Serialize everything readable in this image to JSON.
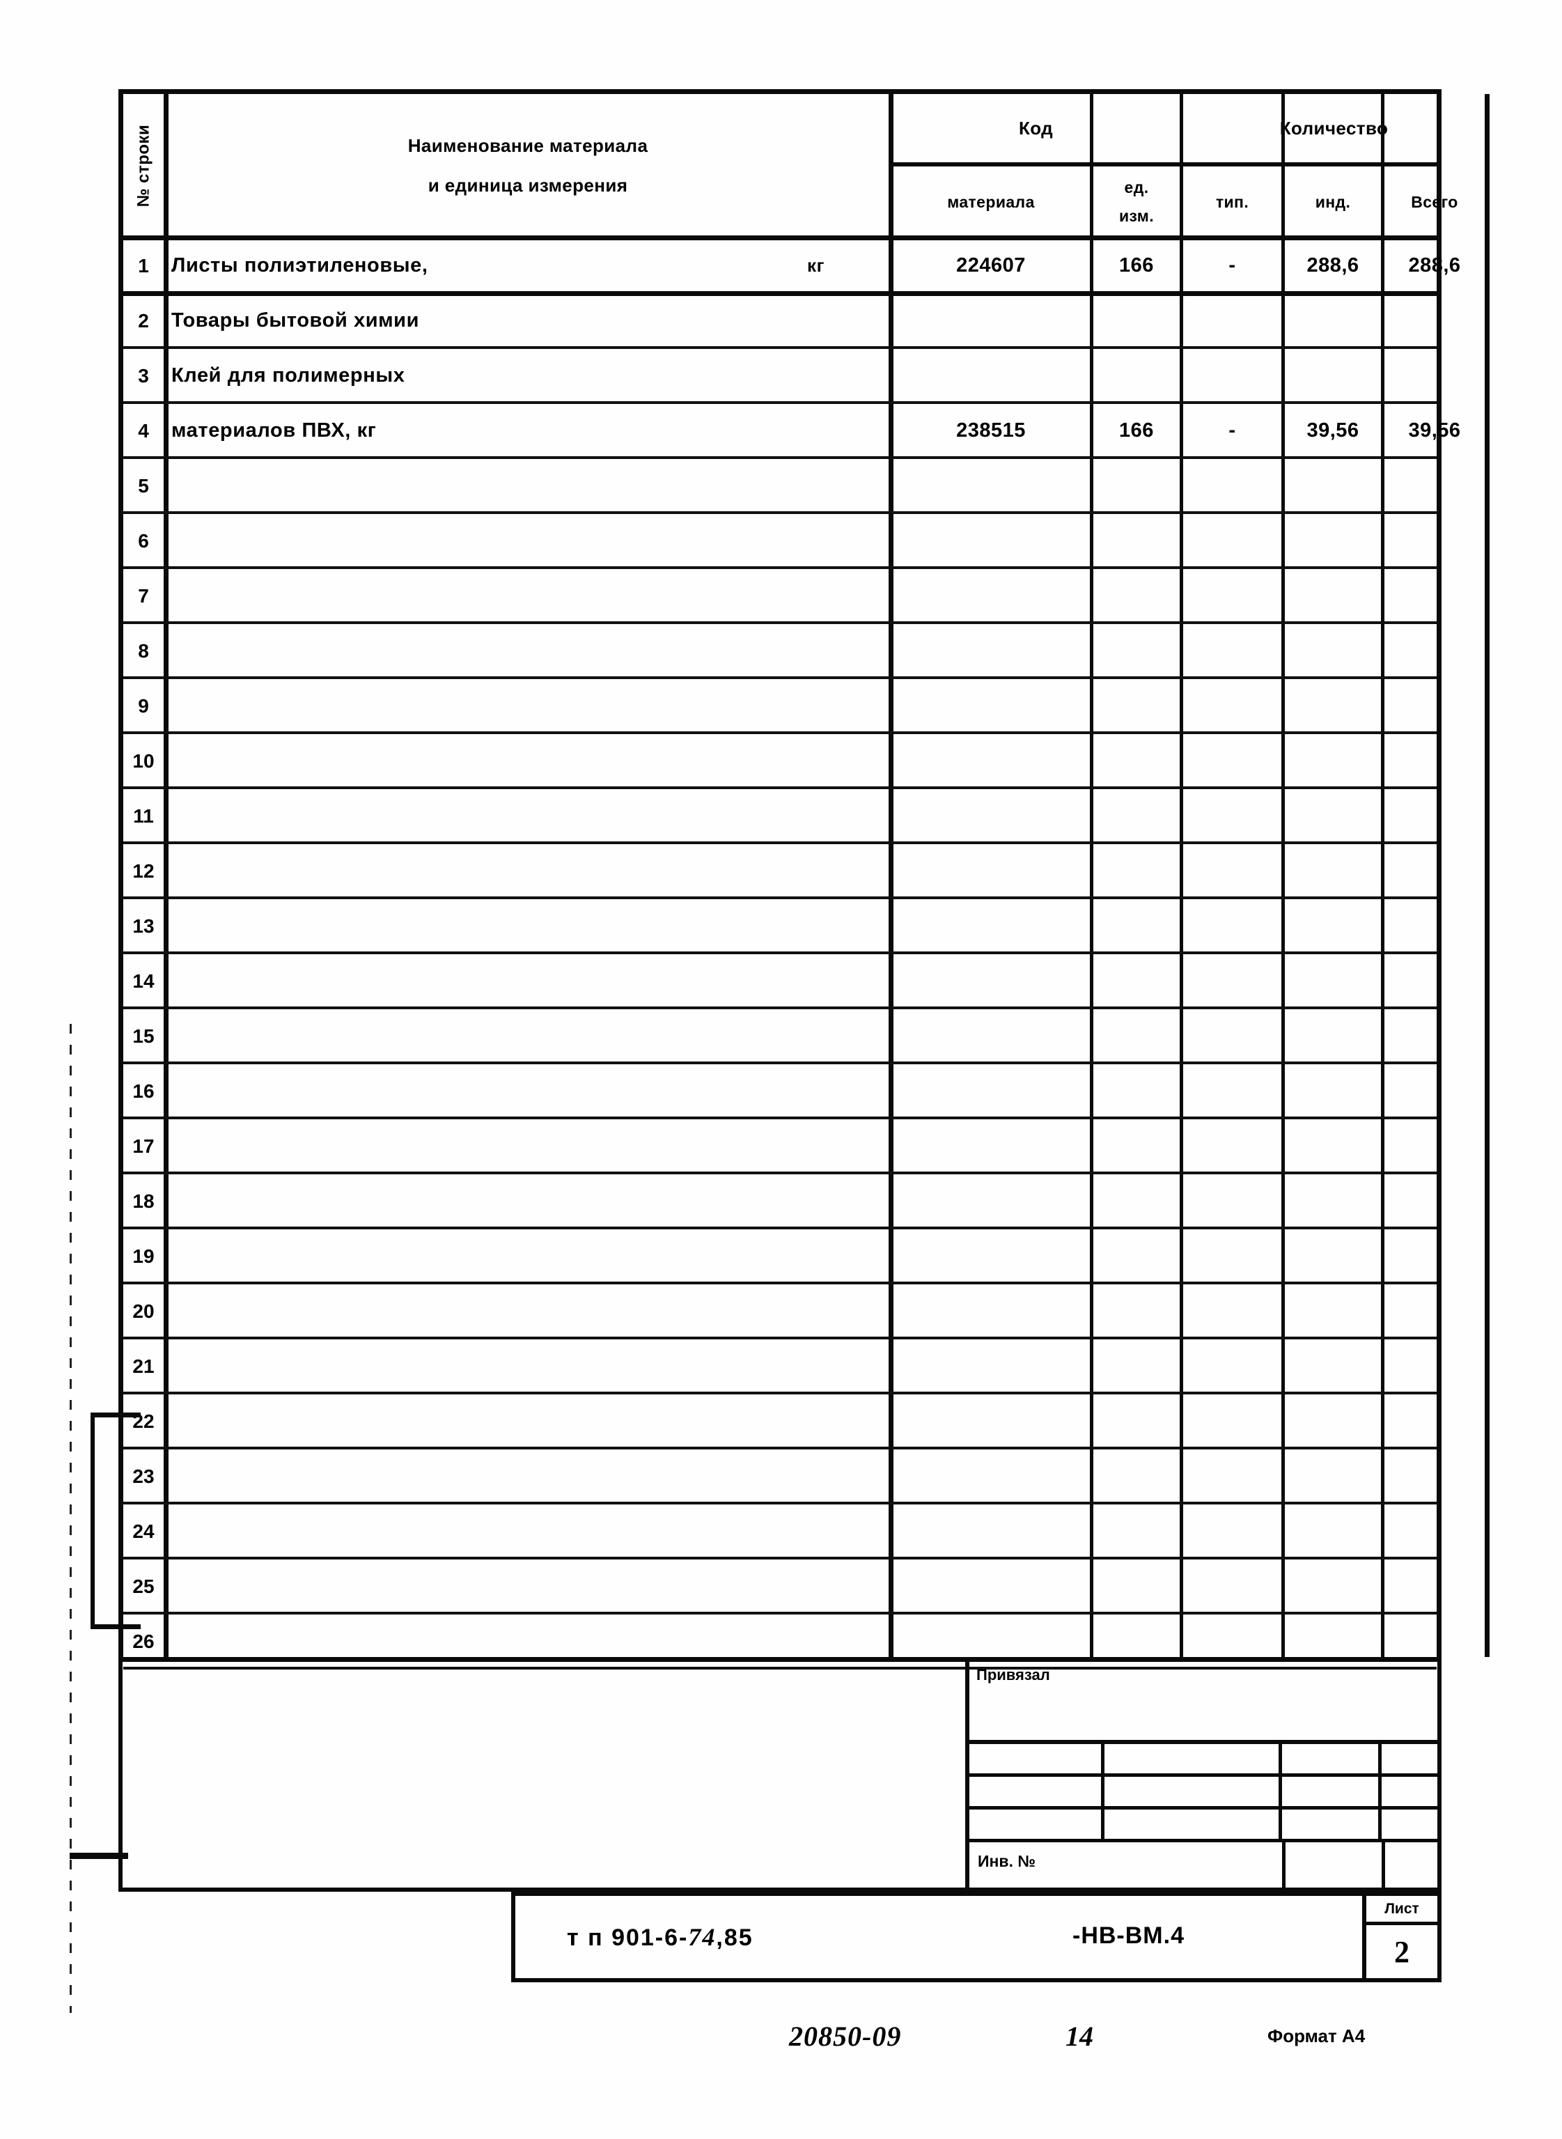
{
  "document": {
    "format_label": "Формат А4",
    "archive_number": "20850-09",
    "page_handwritten": "14"
  },
  "table": {
    "rowno_header": "№ строки",
    "headers": {
      "name": "Наименование материала",
      "name_line2": "и единица измерения",
      "code_group": "Код",
      "code_material": "материала",
      "code_unit_l1": "ед.",
      "code_unit_l2": "изм.",
      "qty_group": "Количество",
      "qty_typ": "тип.",
      "qty_ind": "инд.",
      "qty_total": "Всего"
    },
    "rows": [
      {
        "no": "1",
        "name": "Листы полиэтиленовые,",
        "unit": "кг",
        "material": "224607",
        "uom": "166",
        "typ": "-",
        "ind": "288,6",
        "total": "288,6"
      },
      {
        "no": "2",
        "name": "Товары бытовой химии",
        "unit": "",
        "material": "",
        "uom": "",
        "typ": "",
        "ind": "",
        "total": ""
      },
      {
        "no": "3",
        "name": "Клей для полимерных",
        "unit": "",
        "material": "",
        "uom": "",
        "typ": "",
        "ind": "",
        "total": ""
      },
      {
        "no": "4",
        "name": "материалов ПВХ, кг",
        "unit": "",
        "material": "238515",
        "uom": "166",
        "typ": "-",
        "ind": "39,56",
        "total": "39,56"
      },
      {
        "no": "5",
        "name": "",
        "unit": "",
        "material": "",
        "uom": "",
        "typ": "",
        "ind": "",
        "total": ""
      },
      {
        "no": "6",
        "name": "",
        "unit": "",
        "material": "",
        "uom": "",
        "typ": "",
        "ind": "",
        "total": ""
      },
      {
        "no": "7",
        "name": "",
        "unit": "",
        "material": "",
        "uom": "",
        "typ": "",
        "ind": "",
        "total": ""
      },
      {
        "no": "8",
        "name": "",
        "unit": "",
        "material": "",
        "uom": "",
        "typ": "",
        "ind": "",
        "total": ""
      },
      {
        "no": "9",
        "name": "",
        "unit": "",
        "material": "",
        "uom": "",
        "typ": "",
        "ind": "",
        "total": ""
      },
      {
        "no": "10",
        "name": "",
        "unit": "",
        "material": "",
        "uom": "",
        "typ": "",
        "ind": "",
        "total": ""
      },
      {
        "no": "11",
        "name": "",
        "unit": "",
        "material": "",
        "uom": "",
        "typ": "",
        "ind": "",
        "total": ""
      },
      {
        "no": "12",
        "name": "",
        "unit": "",
        "material": "",
        "uom": "",
        "typ": "",
        "ind": "",
        "total": ""
      },
      {
        "no": "13",
        "name": "",
        "unit": "",
        "material": "",
        "uom": "",
        "typ": "",
        "ind": "",
        "total": ""
      },
      {
        "no": "14",
        "name": "",
        "unit": "",
        "material": "",
        "uom": "",
        "typ": "",
        "ind": "",
        "total": ""
      },
      {
        "no": "15",
        "name": "",
        "unit": "",
        "material": "",
        "uom": "",
        "typ": "",
        "ind": "",
        "total": ""
      },
      {
        "no": "16",
        "name": "",
        "unit": "",
        "material": "",
        "uom": "",
        "typ": "",
        "ind": "",
        "total": ""
      },
      {
        "no": "17",
        "name": "",
        "unit": "",
        "material": "",
        "uom": "",
        "typ": "",
        "ind": "",
        "total": ""
      },
      {
        "no": "18",
        "name": "",
        "unit": "",
        "material": "",
        "uom": "",
        "typ": "",
        "ind": "",
        "total": ""
      },
      {
        "no": "19",
        "name": "",
        "unit": "",
        "material": "",
        "uom": "",
        "typ": "",
        "ind": "",
        "total": ""
      },
      {
        "no": "20",
        "name": "",
        "unit": "",
        "material": "",
        "uom": "",
        "typ": "",
        "ind": "",
        "total": ""
      },
      {
        "no": "21",
        "name": "",
        "unit": "",
        "material": "",
        "uom": "",
        "typ": "",
        "ind": "",
        "total": ""
      },
      {
        "no": "22",
        "name": "",
        "unit": "",
        "material": "",
        "uom": "",
        "typ": "",
        "ind": "",
        "total": ""
      },
      {
        "no": "23",
        "name": "",
        "unit": "",
        "material": "",
        "uom": "",
        "typ": "",
        "ind": "",
        "total": ""
      },
      {
        "no": "24",
        "name": "",
        "unit": "",
        "material": "",
        "uom": "",
        "typ": "",
        "ind": "",
        "total": ""
      },
      {
        "no": "25",
        "name": "",
        "unit": "",
        "material": "",
        "uom": "",
        "typ": "",
        "ind": "",
        "total": ""
      },
      {
        "no": "26",
        "name": "",
        "unit": "",
        "material": "",
        "uom": "",
        "typ": "",
        "ind": "",
        "total": ""
      }
    ]
  },
  "title_block": {
    "privyazal_label": "Привязал",
    "inv_label": "Инв. №",
    "designation_prefix": "т п  901-6-",
    "designation_hand": "74",
    "designation_suffix": ",85",
    "mark": "-НВ-ВМ.4",
    "sheet_label": "Лист",
    "sheet_value": "2"
  }
}
